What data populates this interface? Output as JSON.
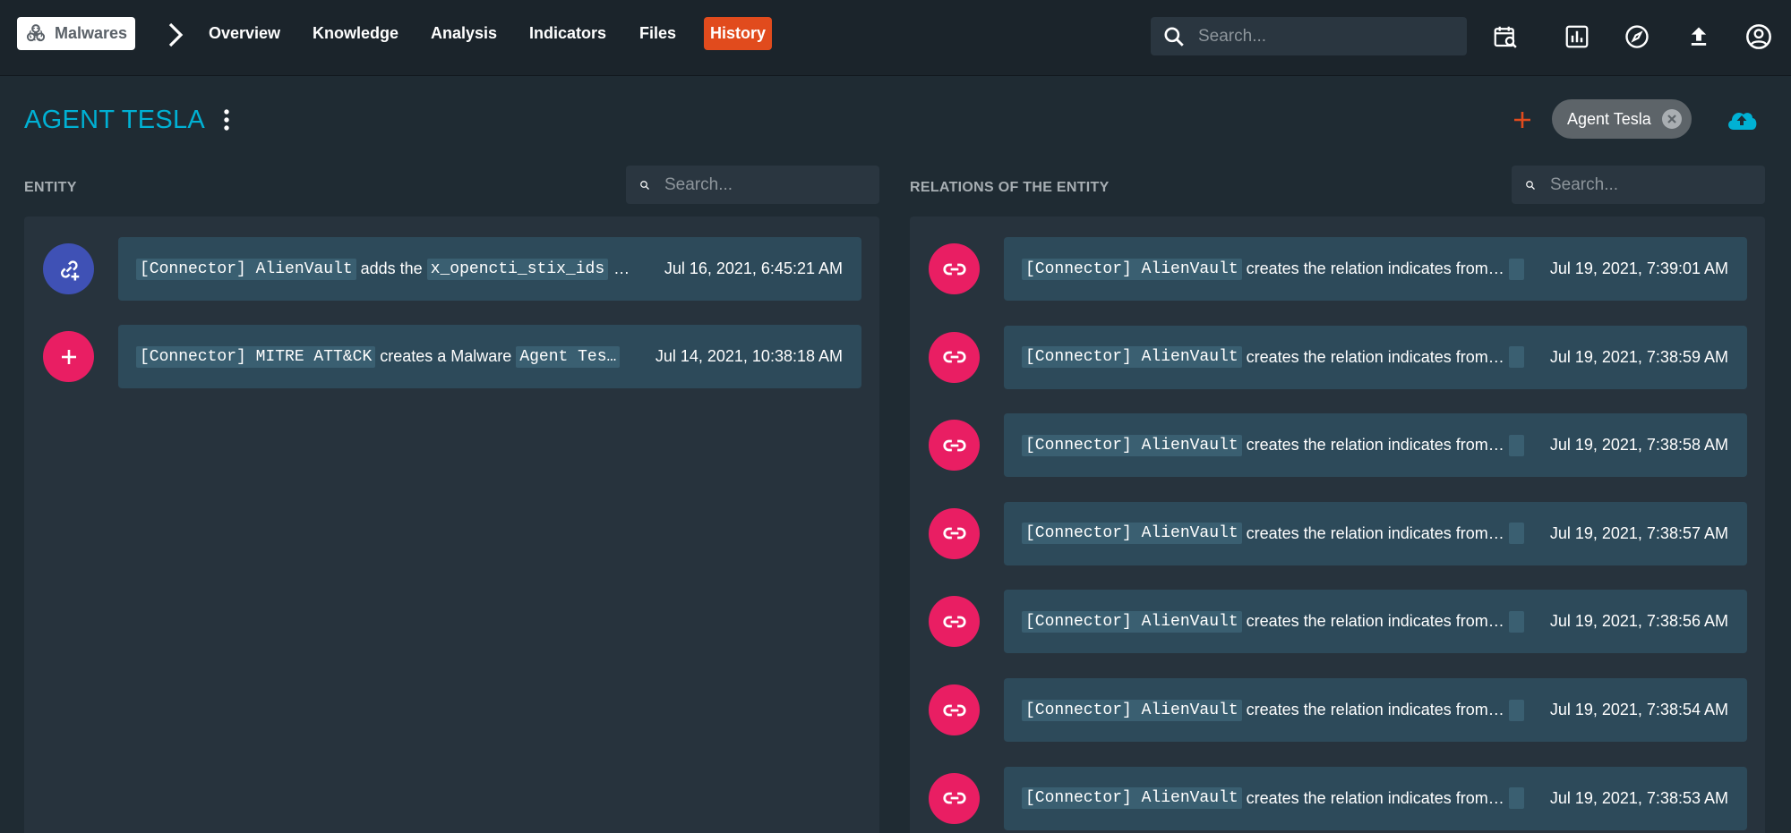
{
  "topbar": {
    "breadcrumb": "Malwares",
    "nav": [
      {
        "label": "Overview"
      },
      {
        "label": "Knowledge"
      },
      {
        "label": "Analysis"
      },
      {
        "label": "Indicators"
      },
      {
        "label": "Files"
      },
      {
        "label": "History",
        "active": true
      }
    ],
    "search_placeholder": "Search..."
  },
  "entity": {
    "title": "AGENT TESLA",
    "tag": "Agent Tesla"
  },
  "entity_panel": {
    "label": "ENTITY",
    "search_placeholder": "Search...",
    "events": [
      {
        "icon": "link-add-icon",
        "color": "#3f51b5",
        "actor": "[Connector] AlienVault",
        "action": "adds the",
        "object": "x_opencti_stix_ids",
        "tail": "…",
        "date": "Jul 16, 2021, 6:45:21 AM"
      },
      {
        "icon": "plus-icon",
        "color": "#e91e63",
        "actor": "[Connector] MITRE ATT&CK",
        "action": "creates a Malware",
        "object": "Agent Tes…",
        "tail": "",
        "date": "Jul 14, 2021, 10:38:18 AM"
      }
    ]
  },
  "relations_panel": {
    "label": "RELATIONS OF THE ENTITY",
    "search_placeholder": "Search...",
    "events": [
      {
        "actor": "[Connector] AlienVault",
        "action": "creates the relation indicates from…",
        "date": "Jul 19, 2021, 7:39:01 AM"
      },
      {
        "actor": "[Connector] AlienVault",
        "action": "creates the relation indicates from…",
        "date": "Jul 19, 2021, 7:38:59 AM"
      },
      {
        "actor": "[Connector] AlienVault",
        "action": "creates the relation indicates from…",
        "date": "Jul 19, 2021, 7:38:58 AM"
      },
      {
        "actor": "[Connector] AlienVault",
        "action": "creates the relation indicates from…",
        "date": "Jul 19, 2021, 7:38:57 AM"
      },
      {
        "actor": "[Connector] AlienVault",
        "action": "creates the relation indicates from…",
        "date": "Jul 19, 2021, 7:38:56 AM"
      },
      {
        "actor": "[Connector] AlienVault",
        "action": "creates the relation indicates from…",
        "date": "Jul 19, 2021, 7:38:54 AM"
      },
      {
        "actor": "[Connector] AlienVault",
        "action": "creates the relation indicates from…",
        "date": "Jul 19, 2021, 7:38:53 AM"
      }
    ],
    "icon": "link-icon",
    "color": "#e91e63"
  },
  "colors": {
    "accent": "#00b1d4",
    "active_tab": "#e14b1d",
    "card": "#2d4a5a",
    "code_bg": "#3a5f71"
  }
}
